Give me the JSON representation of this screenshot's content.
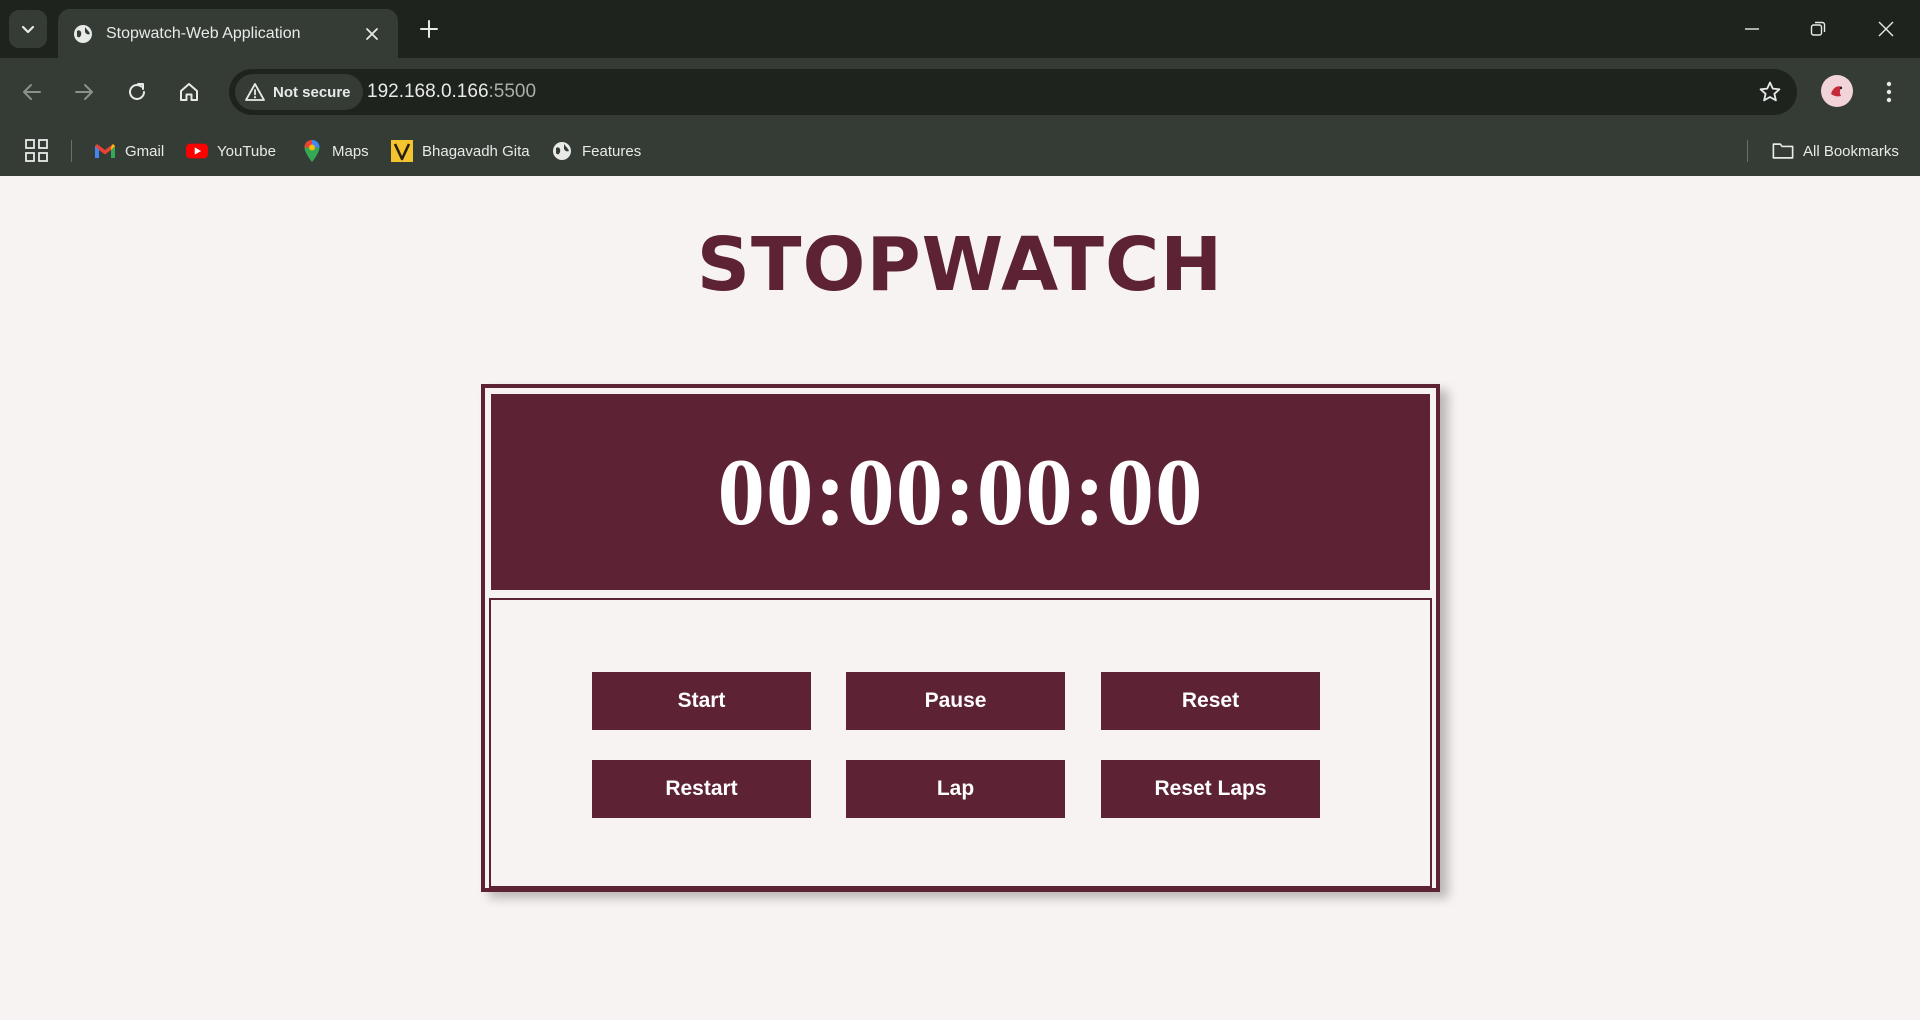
{
  "browser": {
    "tab_title": "Stopwatch-Web Application",
    "security_label": "Not secure",
    "url_host": "192.168.0.166",
    "url_port": ":5500",
    "bookmarks": [
      {
        "label": "Gmail",
        "icon": "gmail-icon"
      },
      {
        "label": "YouTube",
        "icon": "youtube-icon"
      },
      {
        "label": "Maps",
        "icon": "maps-icon"
      },
      {
        "label": "Bhagavadh Gita",
        "icon": "v-logo-icon"
      },
      {
        "label": "Features",
        "icon": "globe-icon"
      }
    ],
    "all_bookmarks_label": "All Bookmarks"
  },
  "page": {
    "title": "STOPWATCH",
    "time": "00:00:00:00",
    "buttons": {
      "start": "Start",
      "pause": "Pause",
      "reset": "Reset",
      "restart": "Restart",
      "lap": "Lap",
      "reset_laps": "Reset Laps"
    }
  },
  "colors": {
    "accent": "#5d2234",
    "page_background": "#f8f3f3",
    "chrome_dark": "#1e231e",
    "chrome_mid": "#353b35"
  }
}
